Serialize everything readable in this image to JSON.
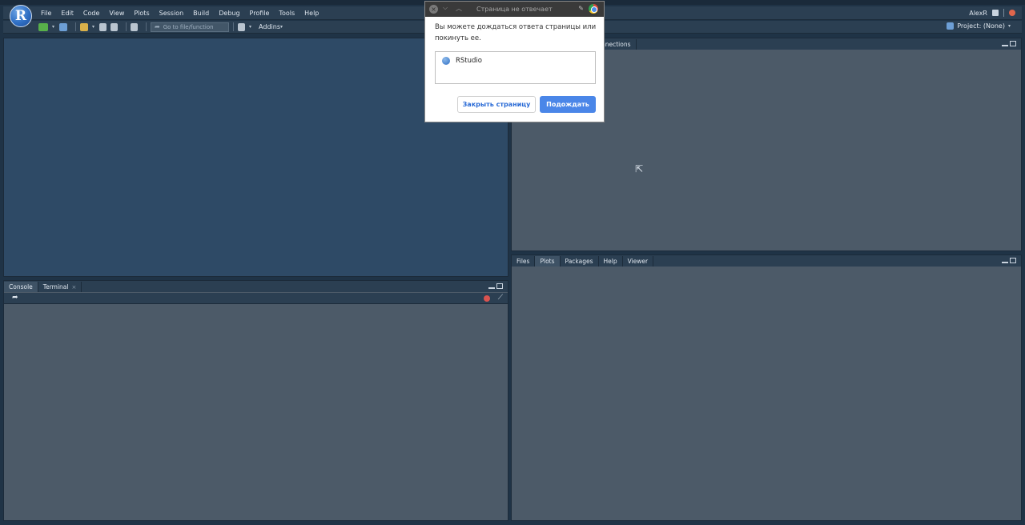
{
  "app": {
    "logo_letter": "R",
    "menu": [
      "File",
      "Edit",
      "Code",
      "View",
      "Plots",
      "Session",
      "Build",
      "Debug",
      "Profile",
      "Tools",
      "Help"
    ],
    "user": "AlexR"
  },
  "toolbar": {
    "goto_placeholder": "Go to file/function",
    "addins_label": "Addins",
    "project_label": "Project: (None)"
  },
  "console_pane": {
    "tabs": [
      {
        "label": "Console",
        "active": true
      },
      {
        "label": "Terminal",
        "active": false,
        "closable": true
      }
    ],
    "close_glyph": "×"
  },
  "env_pane": {
    "visible_tab_fragment": "nnections"
  },
  "files_pane": {
    "tabs": [
      {
        "label": "Files",
        "active": false
      },
      {
        "label": "Plots",
        "active": true
      },
      {
        "label": "Packages",
        "active": false
      },
      {
        "label": "Help",
        "active": false
      },
      {
        "label": "Viewer",
        "active": false
      }
    ]
  },
  "dialog": {
    "title": "Страница не отвечает",
    "message": "Вы можете дождаться ответа страницы или покинуть ее.",
    "list_item": "RStudio",
    "close_button": "Закрыть страницу",
    "wait_button": "Подождать"
  },
  "colors": {
    "source_bg": "#2e4a66",
    "pane_bg": "#4c5a68",
    "primary_button": "#4a86e8"
  },
  "icons": [
    "new-file-icon",
    "open-project-icon",
    "open-file-icon",
    "save-icon",
    "save-all-icon",
    "print-icon",
    "goto-arrow-icon",
    "grid-icon",
    "user-icon",
    "quit-icon",
    "project-icon",
    "go-icon",
    "stop-icon",
    "broom-icon",
    "chrome-icon",
    "pin-icon",
    "close-icon",
    "minimize-icon",
    "maximize-icon",
    "rstudio-icon",
    "mouse-cursor-icon"
  ]
}
